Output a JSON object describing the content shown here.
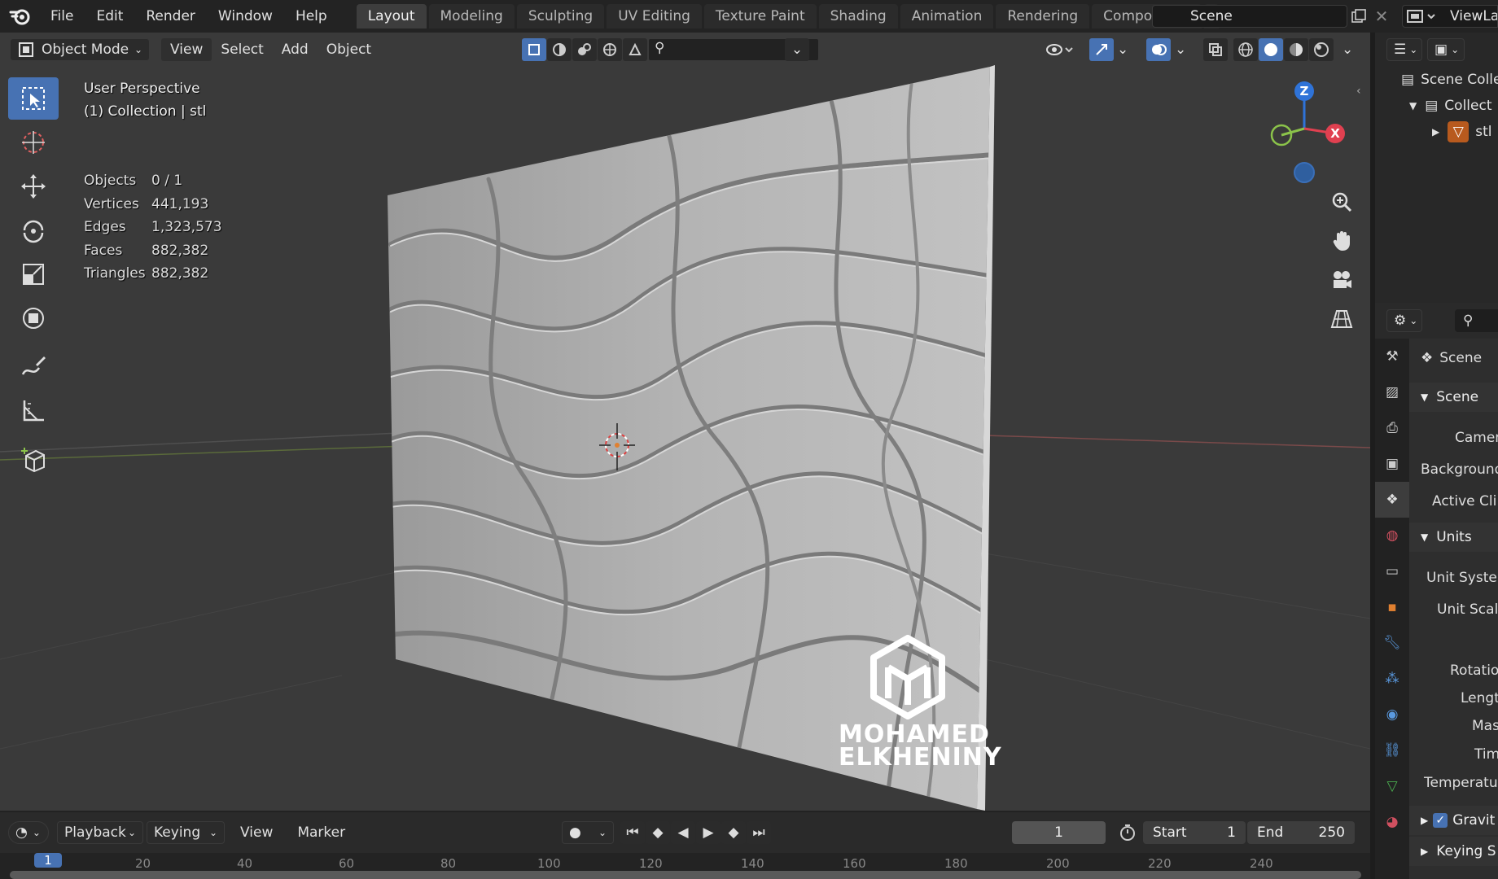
{
  "menu": {
    "items": [
      "File",
      "Edit",
      "Render",
      "Window",
      "Help"
    ]
  },
  "workspace_tabs": [
    "Layout",
    "Modeling",
    "Sculpting",
    "UV Editing",
    "Texture Paint",
    "Shading",
    "Animation",
    "Rendering",
    "Compositing",
    "("
  ],
  "scene_selector": {
    "value": "Scene"
  },
  "view_layer_selector": {
    "value": "ViewLa"
  },
  "viewport_header": {
    "mode": "Object Mode",
    "view": "View",
    "select": "Select",
    "add": "Add",
    "object": "Object"
  },
  "viewport_overlay": {
    "perspective": "User Perspective",
    "collection": "(1) Collection | stl"
  },
  "stats": [
    {
      "label": "Objects",
      "value": "0 / 1"
    },
    {
      "label": "Vertices",
      "value": "441,193"
    },
    {
      "label": "Edges",
      "value": "1,323,573"
    },
    {
      "label": "Faces",
      "value": "882,382"
    },
    {
      "label": "Triangles",
      "value": "882,382"
    }
  ],
  "gizmo": {
    "z": "Z",
    "x": "X"
  },
  "watermark": {
    "line1": "MOHAMED",
    "line2": "ELKHENINY"
  },
  "timeline": {
    "playback": "Playback",
    "keying": "Keying",
    "view": "View",
    "marker": "Marker",
    "current_frame": "1",
    "start_label": "Start",
    "start_value": "1",
    "end_label": "End",
    "end_value": "250",
    "ruler_ticks": [
      "1",
      "20",
      "40",
      "60",
      "80",
      "100",
      "120",
      "140",
      "160",
      "180",
      "200",
      "220",
      "240"
    ]
  },
  "outliner": {
    "rows": [
      "Scene Colle",
      "Collect",
      "stl"
    ]
  },
  "properties": {
    "context": "Scene",
    "scene_section": "Scene",
    "camera": "Camer",
    "background": "Background",
    "active_clip": "Active Cli",
    "units_section": "Units",
    "unit_system": "Unit Systen",
    "unit_scale": "Unit Scal",
    "rotation": "Rotatio",
    "length": "Lengt",
    "mass": "Mas",
    "time": "Tim",
    "temperature": "Temperatur",
    "gravity": "Gravit",
    "keying_sets": "Keying S"
  },
  "colors": {
    "accent": "#4772b3",
    "axis_x": "#e04050",
    "axis_y": "#8bc34a",
    "axis_z": "#2f73d8"
  }
}
